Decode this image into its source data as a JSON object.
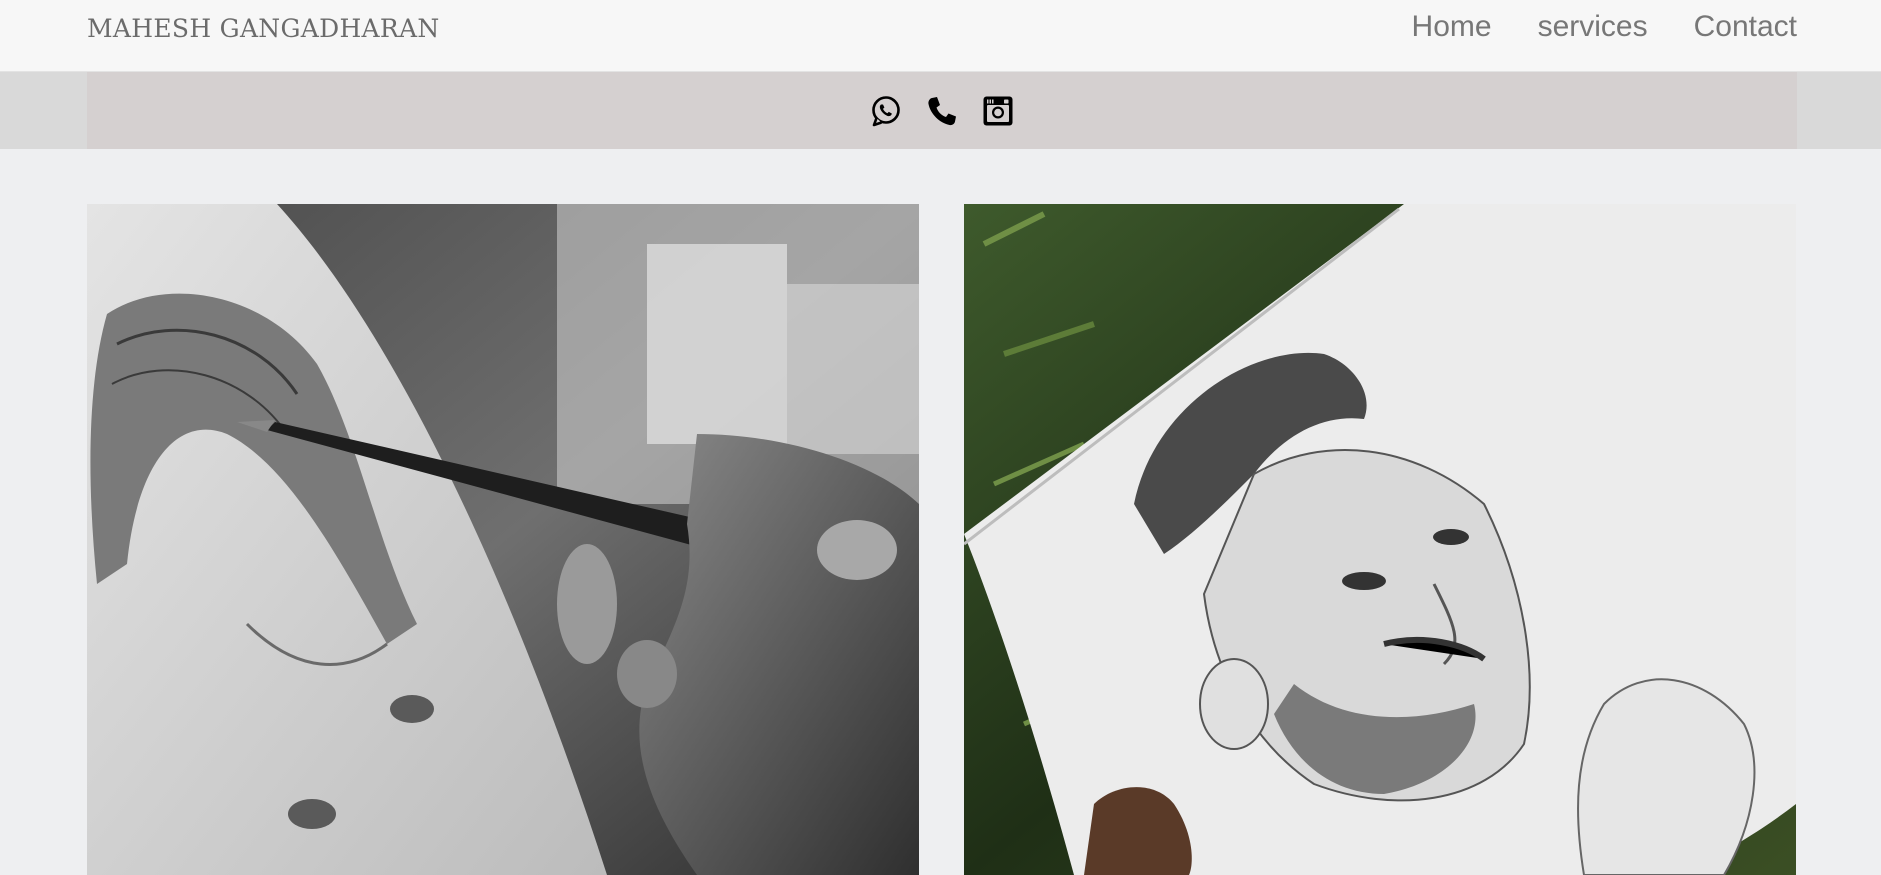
{
  "brand": {
    "name": "MAHESH GANGADHARAN"
  },
  "nav": {
    "items": [
      {
        "label": "Home"
      },
      {
        "label": "services"
      },
      {
        "label": "Contact"
      }
    ]
  },
  "social": {
    "icons": [
      "whatsapp-icon",
      "phone-icon",
      "instagram-icon"
    ]
  },
  "gallery": {
    "items": [
      {
        "subject": "hand-pencil-sketching-child-portrait"
      },
      {
        "subject": "hand-holding-pencil-portrait-of-bearded-man"
      }
    ]
  },
  "colors": {
    "page_bg": "#eeeff1",
    "header_bg": "#f7f7f7",
    "social_strip_bg": "#d5d0d0",
    "nav_text": "#777777",
    "brand_text": "#6b6b6b"
  }
}
